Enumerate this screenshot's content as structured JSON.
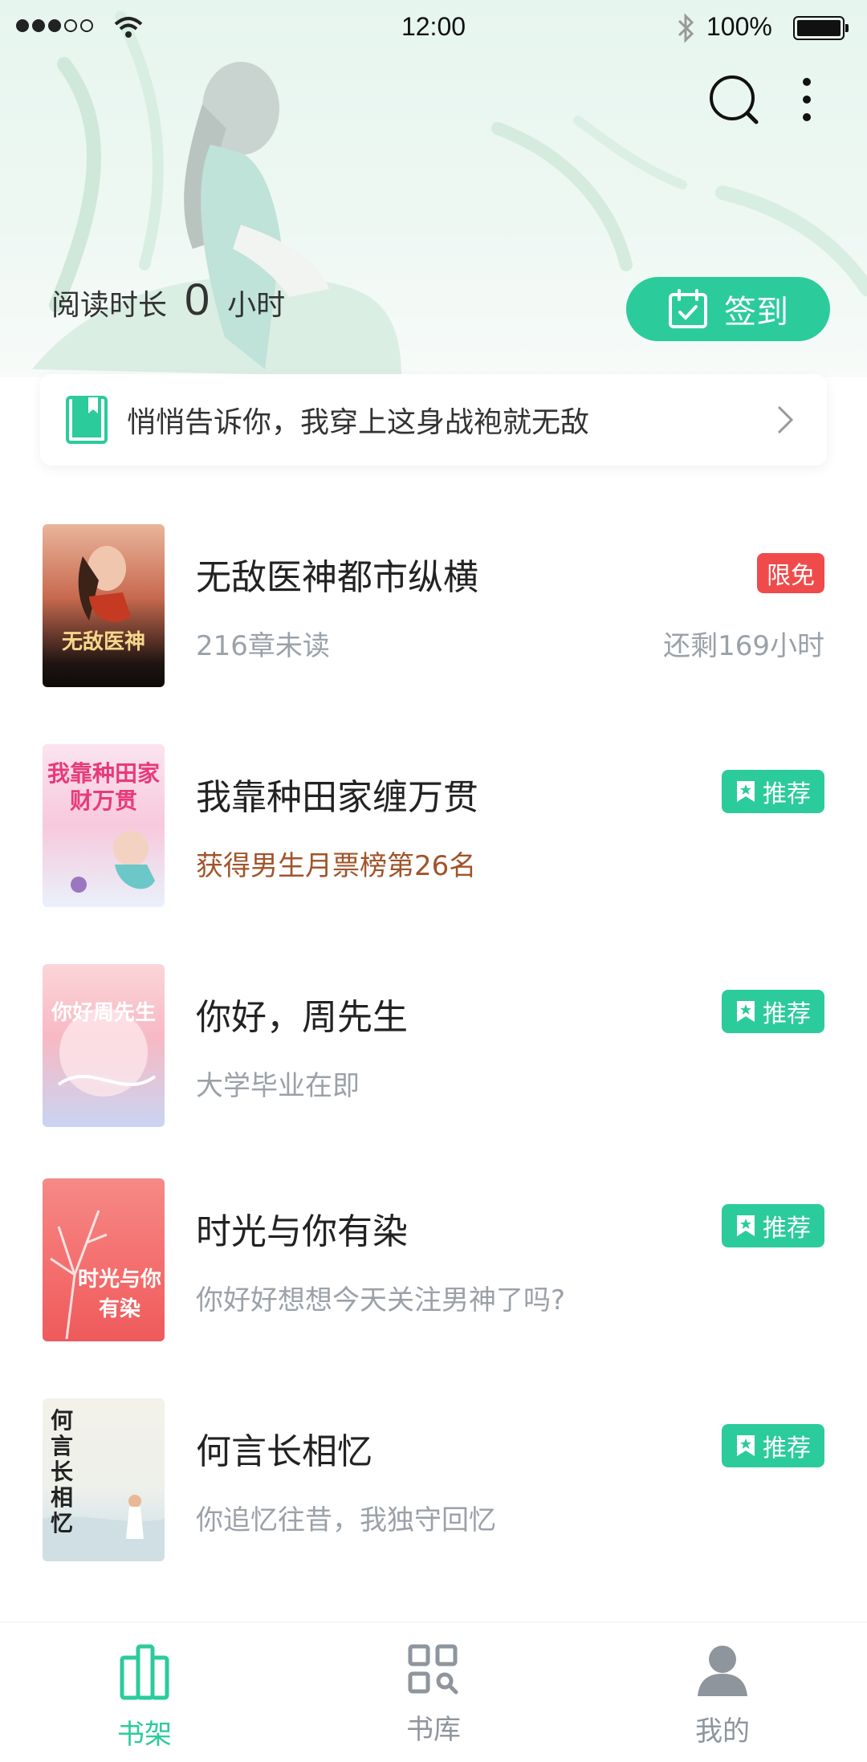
{
  "status_bar": {
    "time": "12:00",
    "battery": "100%"
  },
  "header": {
    "reading_label": "阅读时长",
    "reading_value": "0",
    "reading_unit": "小时",
    "checkin_label": "签到"
  },
  "notice": {
    "text": "悄悄告诉你，我穿上这身战袍就无敌"
  },
  "books": [
    {
      "title": "无敌医神都市纵横",
      "subtitle": "216章未读",
      "right_text": "还剩169小时",
      "tag": "限免",
      "cover_text": "无敌医神"
    },
    {
      "title": "我靠种田家缠万贯",
      "subtitle": "获得男生月票榜第26名",
      "tag": "推荐",
      "cover_text": "我靠种田家财万贯"
    },
    {
      "title": "你好，周先生",
      "subtitle": "大学毕业在即",
      "tag": "推荐",
      "cover_text": "你好周先生"
    },
    {
      "title": "时光与你有染",
      "subtitle": "你好好想想今天关注男神了吗?",
      "tag": "推荐",
      "cover_text": "时光与你有染"
    },
    {
      "title": "何言长相忆",
      "subtitle": "你追忆往昔，我独守回忆",
      "tag": "推荐",
      "cover_text": "何言长相忆"
    }
  ],
  "tabs": [
    {
      "label": "书架",
      "icon": "bookshelf-icon",
      "active": true
    },
    {
      "label": "书库",
      "icon": "library-icon",
      "active": false
    },
    {
      "label": "我的",
      "icon": "profile-icon",
      "active": false
    }
  ],
  "colors": {
    "accent": "#2ccb9c",
    "free_tag": "#f04b4b",
    "rank_text": "#a0542a"
  }
}
